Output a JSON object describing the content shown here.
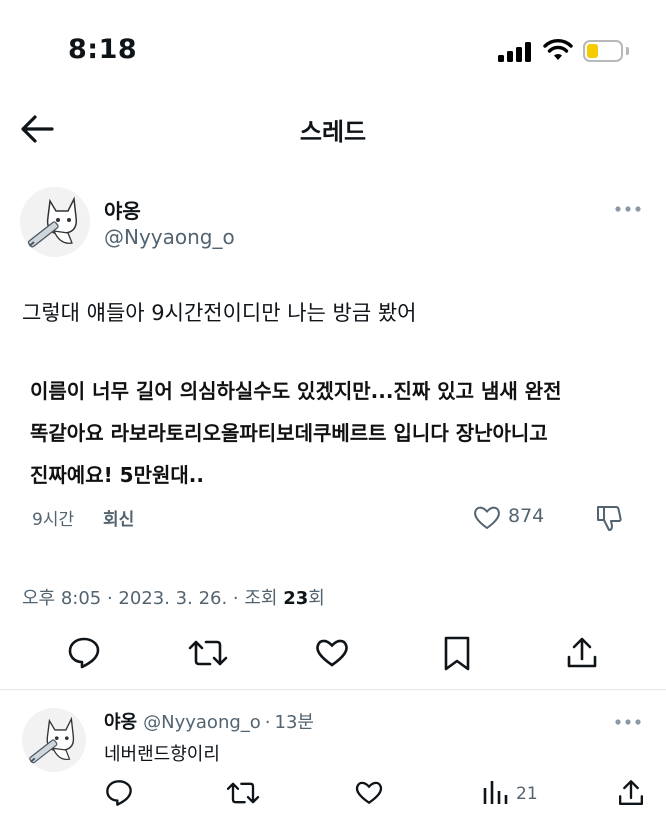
{
  "status_bar": {
    "time": "8:18",
    "icons": [
      "signal-icon",
      "wifi-icon",
      "battery-icon"
    ],
    "battery_color": "#f6cc00"
  },
  "nav": {
    "title": "스레드",
    "back_icon": "arrow-left-icon"
  },
  "tweet": {
    "author_name": "야옹",
    "author_handle": "@Nyyaong_o",
    "text": "그렇대 얘들아 9시간전이디만 나는 방금 봤어",
    "quote_lines": [
      "이름이 너무 길어 의심하실수도 있겠지만...진짜 있고 냄새 완전",
      "똑같아요 라보라토리오올파티보데쿠베르트 입니다 장난아니고",
      "진짜예요! 5만원대.."
    ],
    "meta_time": "9시간",
    "meta_reply": "회신",
    "like_count": "874",
    "timestamp_prefix": "오후 8:05 · 2023. 3. 26. · 조회 ",
    "views": "23",
    "views_suffix": "회",
    "action_icons": [
      "reply-icon",
      "retweet-icon",
      "like-icon",
      "bookmark-icon",
      "share-icon"
    ]
  },
  "reply": {
    "author_name": "야옹",
    "author_handle": "@Nyyaong_o",
    "dot": "·",
    "time": "13분",
    "text": "네버랜드향이리",
    "views": "21"
  },
  "colors": {
    "text_primary": "#0f1419",
    "text_secondary": "#536471",
    "divider": "#e6e6e6"
  }
}
